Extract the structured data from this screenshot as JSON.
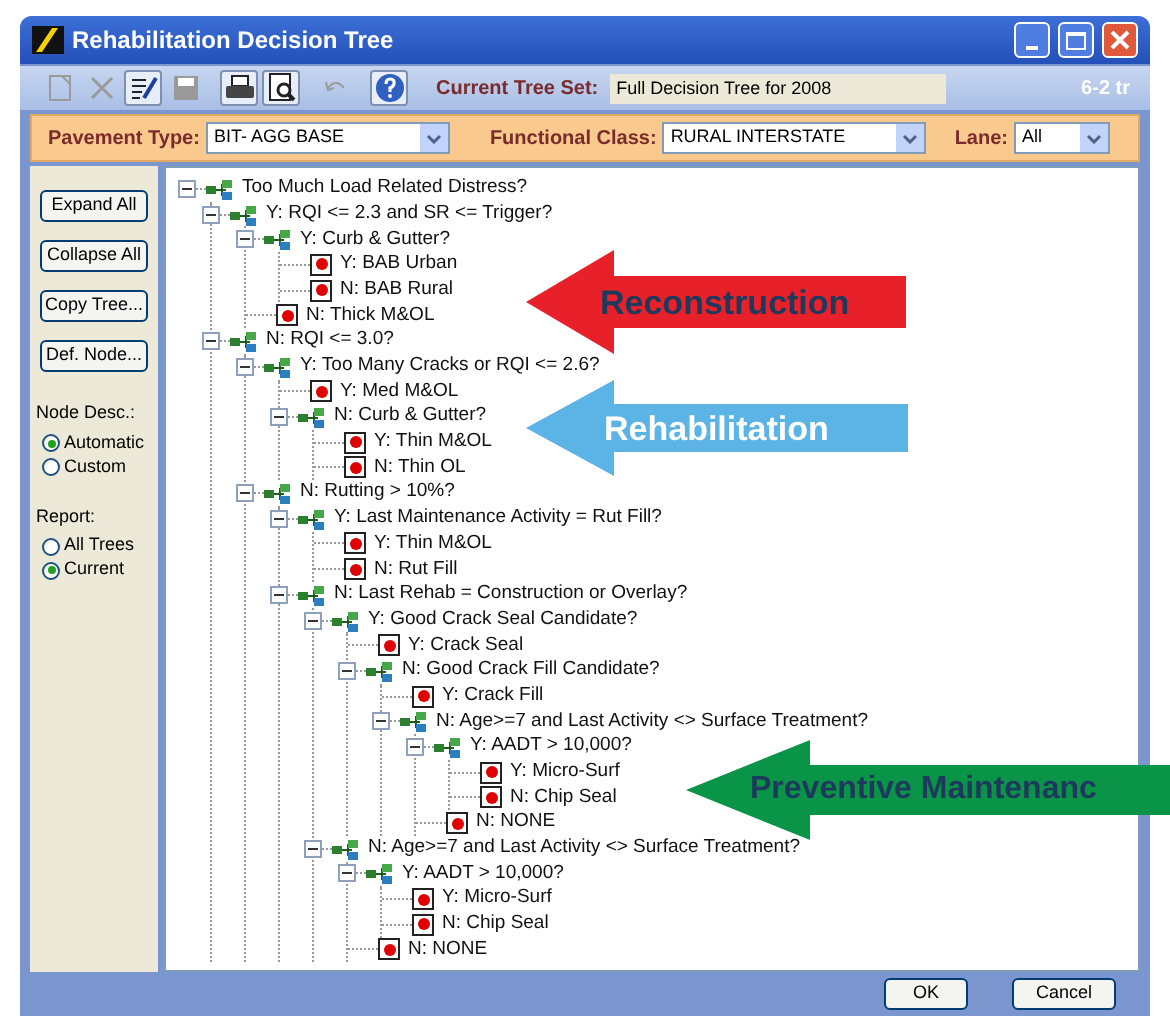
{
  "window": {
    "title": "Rehabilitation Decision Tree"
  },
  "toolbar": [
    {
      "kind": "new",
      "disabled": true
    },
    {
      "kind": "delete",
      "disabled": true
    },
    {
      "kind": "edit",
      "disabled": false
    },
    {
      "kind": "save",
      "disabled": true
    },
    {
      "kind": "print",
      "disabled": false
    },
    {
      "kind": "preview",
      "disabled": false
    },
    {
      "kind": "undo",
      "disabled": true
    },
    {
      "kind": "help",
      "disabled": false
    }
  ],
  "current_tree_set": {
    "label": "Current Tree Set:",
    "value": "Full Decision Tree for 2008"
  },
  "toolbar_corner_text": "6-2 tr",
  "filters": [
    {
      "label": "Pavement Type:",
      "value": "BIT- AGG BASE"
    },
    {
      "label": "Functional Class:",
      "value": "RURAL INTERSTATE"
    },
    {
      "label": "Lane:",
      "value": "All"
    }
  ],
  "side_buttons": [
    "Expand All",
    "Collapse All",
    "Copy Tree...",
    "Def. Node..."
  ],
  "node_desc": {
    "label": "Node Desc.:",
    "options": [
      {
        "label": "Automatic",
        "selected": true
      },
      {
        "label": "Custom",
        "selected": false
      }
    ]
  },
  "report": {
    "label": "Report:",
    "options": [
      {
        "label": "All Trees",
        "selected": false
      },
      {
        "label": "Current",
        "selected": true
      }
    ]
  },
  "tree": [
    {
      "kind": "branch",
      "label": "Too Much Load Related Distress?",
      "expanded": true,
      "children": [
        {
          "kind": "branch",
          "label": "Y: RQI <= 2.3 and SR <= Trigger?",
          "expanded": true,
          "children": [
            {
              "kind": "branch",
              "label": "Y: Curb & Gutter?",
              "expanded": true,
              "children": [
                {
                  "kind": "leaf",
                  "label": "Y: BAB Urban"
                },
                {
                  "kind": "leaf",
                  "label": "N: BAB Rural"
                }
              ]
            },
            {
              "kind": "leaf",
              "label": "N: Thick M&OL"
            }
          ]
        },
        {
          "kind": "branch",
          "label": "N: RQI <= 3.0?",
          "expanded": true,
          "children": [
            {
              "kind": "branch",
              "label": "Y: Too Many Cracks or RQI <= 2.6?",
              "expanded": true,
              "children": [
                {
                  "kind": "leaf",
                  "label": "Y: Med M&OL"
                },
                {
                  "kind": "branch",
                  "label": "N: Curb & Gutter?",
                  "expanded": true,
                  "children": [
                    {
                      "kind": "leaf",
                      "label": "Y: Thin M&OL"
                    },
                    {
                      "kind": "leaf",
                      "label": "N: Thin OL"
                    }
                  ]
                }
              ]
            },
            {
              "kind": "branch",
              "label": "N: Rutting > 10%?",
              "expanded": true,
              "children": [
                {
                  "kind": "branch",
                  "label": "Y: Last Maintenance Activity = Rut Fill?",
                  "expanded": true,
                  "children": [
                    {
                      "kind": "leaf",
                      "label": "Y: Thin M&OL"
                    },
                    {
                      "kind": "leaf",
                      "label": "N: Rut Fill"
                    }
                  ]
                },
                {
                  "kind": "branch",
                  "label": "N: Last Rehab = Construction or Overlay?",
                  "expanded": true,
                  "children": [
                    {
                      "kind": "branch",
                      "label": "Y: Good Crack Seal Candidate?",
                      "expanded": true,
                      "children": [
                        {
                          "kind": "leaf",
                          "label": "Y: Crack Seal"
                        },
                        {
                          "kind": "branch",
                          "label": "N: Good Crack Fill Candidate?",
                          "expanded": true,
                          "children": [
                            {
                              "kind": "leaf",
                              "label": "Y: Crack Fill"
                            },
                            {
                              "kind": "branch",
                              "label": "N: Age>=7 and Last Activity <> Surface Treatment?",
                              "expanded": true,
                              "children": [
                                {
                                  "kind": "branch",
                                  "label": "Y: AADT > 10,000?",
                                  "expanded": true,
                                  "children": [
                                    {
                                      "kind": "leaf",
                                      "label": "Y: Micro-Surf"
                                    },
                                    {
                                      "kind": "leaf",
                                      "label": "N: Chip Seal"
                                    }
                                  ]
                                },
                                {
                                  "kind": "leaf",
                                  "label": "N: NONE"
                                }
                              ]
                            }
                          ]
                        }
                      ]
                    },
                    {
                      "kind": "branch",
                      "label": "N: Age>=7 and Last Activity <> Surface Treatment?",
                      "expanded": true,
                      "children": [
                        {
                          "kind": "branch",
                          "label": "Y: AADT > 10,000?",
                          "expanded": true,
                          "children": [
                            {
                              "kind": "leaf",
                              "label": "Y: Micro-Surf"
                            },
                            {
                              "kind": "leaf",
                              "label": "N: Chip Seal"
                            }
                          ]
                        },
                        {
                          "kind": "leaf",
                          "label": "N: NONE"
                        }
                      ]
                    }
                  ]
                }
              ]
            }
          ]
        }
      ]
    }
  ],
  "annotations": [
    {
      "kind": "red",
      "label": "Reconstruction"
    },
    {
      "kind": "blue",
      "label": "Rehabilitation"
    },
    {
      "kind": "green",
      "label": "Preventive Maintenanc"
    }
  ],
  "buttons": [
    "OK",
    "Cancel"
  ]
}
